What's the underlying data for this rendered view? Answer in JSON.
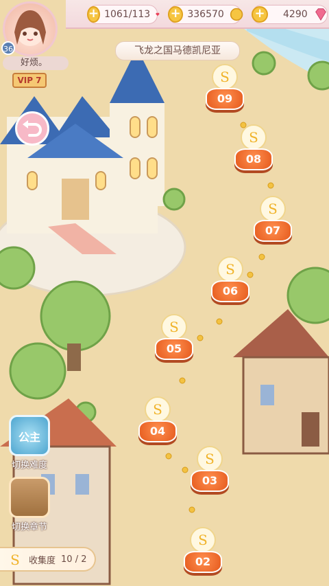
{
  "hud": {
    "lives": "1061/113",
    "coins": "336570",
    "gems": "4290"
  },
  "player": {
    "level": "36",
    "name": "好烦。",
    "vip": "VIP 7"
  },
  "region": {
    "title": "飞龙之国马德凯尼亚"
  },
  "stages": [
    {
      "num": "09"
    },
    {
      "num": "08"
    },
    {
      "num": "07"
    },
    {
      "num": "06"
    },
    {
      "num": "05"
    },
    {
      "num": "04"
    },
    {
      "num": "03"
    },
    {
      "num": "02"
    }
  ],
  "side_buttons": {
    "difficulty": {
      "badge": "公主",
      "label": "切换难度"
    },
    "chapter": {
      "label": "切换章节"
    }
  },
  "collection": {
    "label": "收集度",
    "value": "10 / 2"
  },
  "colors": {
    "stage_disc": "#e55a1d",
    "hud_bg": "#f7e7e7",
    "map_ground": "#efd9a8"
  }
}
